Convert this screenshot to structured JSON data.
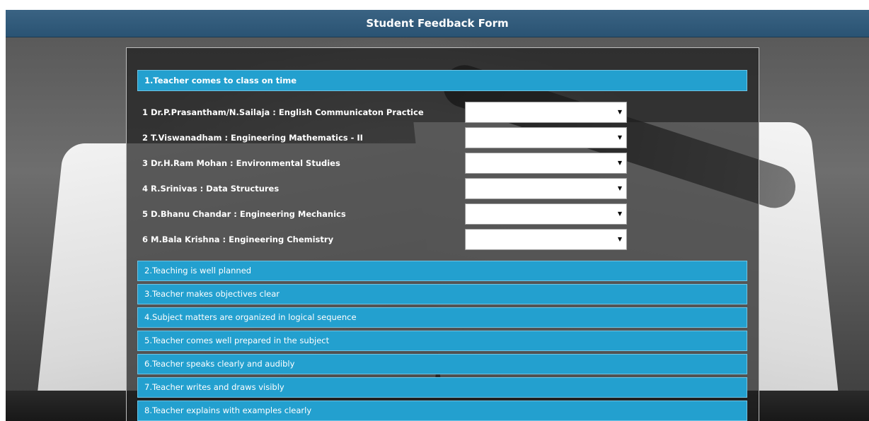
{
  "header": {
    "title": "Student Feedback Form"
  },
  "questions": [
    {
      "label": "1.Teacher comes to class on time",
      "rows": [
        {
          "label": "1 Dr.P.Prasantham/N.Sailaja : English Communicaton Practice",
          "value": ""
        },
        {
          "label": "2 T.Viswanadham : Engineering Mathematics - II",
          "value": ""
        },
        {
          "label": "3 Dr.H.Ram Mohan : Environmental Studies",
          "value": ""
        },
        {
          "label": "4 R.Srinivas : Data Structures",
          "value": ""
        },
        {
          "label": "5 D.Bhanu Chandar : Engineering Mechanics",
          "value": ""
        },
        {
          "label": "6 M.Bala Krishna : Engineering Chemistry",
          "value": ""
        }
      ]
    },
    {
      "label": "2.Teaching is well planned"
    },
    {
      "label": "3.Teacher makes objectives clear"
    },
    {
      "label": "4.Subject matters are organized in logical sequence"
    },
    {
      "label": "5.Teacher comes well prepared in the subject"
    },
    {
      "label": "6.Teacher speaks clearly and audibly"
    },
    {
      "label": "7.Teacher writes and draws visibly"
    },
    {
      "label": "8.Teacher explains with examples clearly"
    }
  ],
  "icons": {
    "dropdown": "triangle-down-icon"
  },
  "colors": {
    "header": "#2f5a7a",
    "question_bar": "#23a0cf"
  }
}
